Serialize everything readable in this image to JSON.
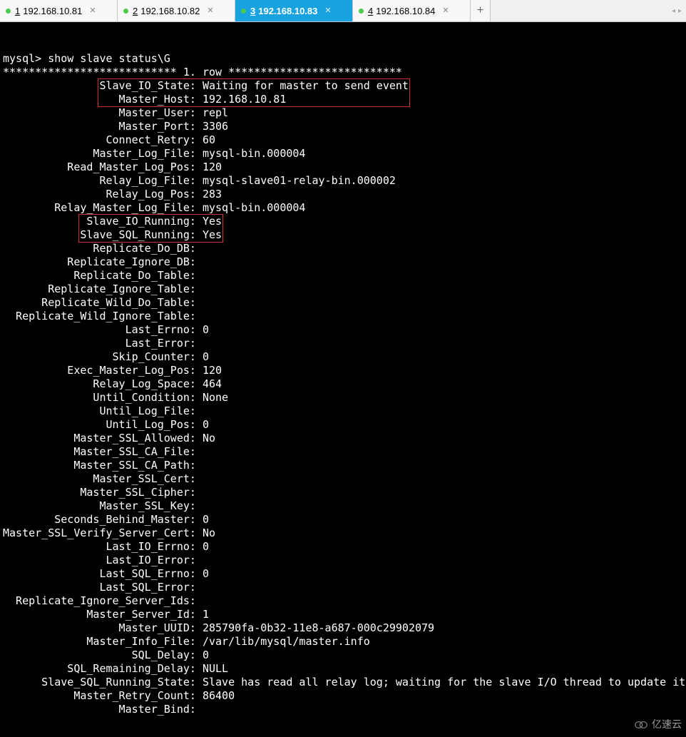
{
  "tabs": [
    {
      "num": "1",
      "ip": "192.168.10.81",
      "active": false
    },
    {
      "num": "2",
      "ip": "192.168.10.82",
      "active": false
    },
    {
      "num": "3",
      "ip": "192.168.10.83",
      "active": true
    },
    {
      "num": "4",
      "ip": "192.168.10.84",
      "active": false
    }
  ],
  "newtab_label": "+",
  "nav": {
    "left": "◂",
    "right": "▸"
  },
  "terminal": {
    "prompt": "mysql> show slave status\\G",
    "rowheader": "*************************** 1. row ***************************",
    "fields": [
      {
        "k": "Slave_IO_State",
        "v": "Waiting for master to send event"
      },
      {
        "k": "Master_Host",
        "v": "192.168.10.81"
      },
      {
        "k": "Master_User",
        "v": "repl"
      },
      {
        "k": "Master_Port",
        "v": "3306"
      },
      {
        "k": "Connect_Retry",
        "v": "60"
      },
      {
        "k": "Master_Log_File",
        "v": "mysql-bin.000004"
      },
      {
        "k": "Read_Master_Log_Pos",
        "v": "120"
      },
      {
        "k": "Relay_Log_File",
        "v": "mysql-slave01-relay-bin.000002"
      },
      {
        "k": "Relay_Log_Pos",
        "v": "283"
      },
      {
        "k": "Relay_Master_Log_File",
        "v": "mysql-bin.000004"
      },
      {
        "k": "Slave_IO_Running",
        "v": "Yes"
      },
      {
        "k": "Slave_SQL_Running",
        "v": "Yes"
      },
      {
        "k": "Replicate_Do_DB",
        "v": ""
      },
      {
        "k": "Replicate_Ignore_DB",
        "v": ""
      },
      {
        "k": "Replicate_Do_Table",
        "v": ""
      },
      {
        "k": "Replicate_Ignore_Table",
        "v": ""
      },
      {
        "k": "Replicate_Wild_Do_Table",
        "v": ""
      },
      {
        "k": "Replicate_Wild_Ignore_Table",
        "v": ""
      },
      {
        "k": "Last_Errno",
        "v": "0"
      },
      {
        "k": "Last_Error",
        "v": ""
      },
      {
        "k": "Skip_Counter",
        "v": "0"
      },
      {
        "k": "Exec_Master_Log_Pos",
        "v": "120"
      },
      {
        "k": "Relay_Log_Space",
        "v": "464"
      },
      {
        "k": "Until_Condition",
        "v": "None"
      },
      {
        "k": "Until_Log_File",
        "v": ""
      },
      {
        "k": "Until_Log_Pos",
        "v": "0"
      },
      {
        "k": "Master_SSL_Allowed",
        "v": "No"
      },
      {
        "k": "Master_SSL_CA_File",
        "v": ""
      },
      {
        "k": "Master_SSL_CA_Path",
        "v": ""
      },
      {
        "k": "Master_SSL_Cert",
        "v": ""
      },
      {
        "k": "Master_SSL_Cipher",
        "v": ""
      },
      {
        "k": "Master_SSL_Key",
        "v": ""
      },
      {
        "k": "Seconds_Behind_Master",
        "v": "0"
      },
      {
        "k": "Master_SSL_Verify_Server_Cert",
        "v": "No"
      },
      {
        "k": "Last_IO_Errno",
        "v": "0"
      },
      {
        "k": "Last_IO_Error",
        "v": ""
      },
      {
        "k": "Last_SQL_Errno",
        "v": "0"
      },
      {
        "k": "Last_SQL_Error",
        "v": ""
      },
      {
        "k": "Replicate_Ignore_Server_Ids",
        "v": ""
      },
      {
        "k": "Master_Server_Id",
        "v": "1"
      },
      {
        "k": "Master_UUID",
        "v": "285790fa-0b32-11e8-a687-000c29902079"
      },
      {
        "k": "Master_Info_File",
        "v": "/var/lib/mysql/master.info"
      },
      {
        "k": "SQL_Delay",
        "v": "0"
      },
      {
        "k": "SQL_Remaining_Delay",
        "v": "NULL"
      },
      {
        "k": "Slave_SQL_Running_State",
        "v": "Slave has read all relay log; waiting for the slave I/O thread to update it"
      },
      {
        "k": "Master_Retry_Count",
        "v": "86400"
      },
      {
        "k": "Master_Bind",
        "v": ""
      }
    ],
    "label_width": 29,
    "highlight_boxes": [
      {
        "from": 0,
        "to": 1
      },
      {
        "from": 10,
        "to": 11
      }
    ]
  },
  "watermark": "亿速云"
}
